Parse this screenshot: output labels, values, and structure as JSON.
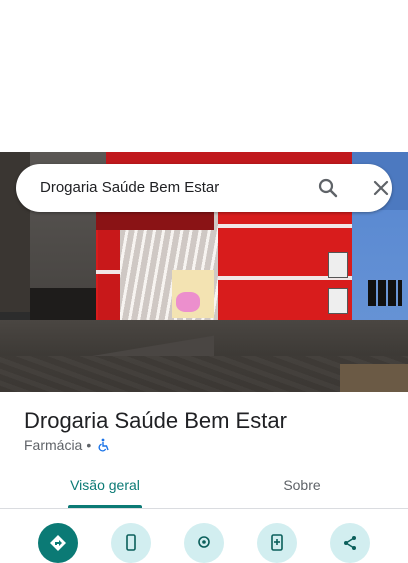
{
  "search": {
    "query": "Drogaria Saúde Bem Estar"
  },
  "place": {
    "name": "Drogaria Saúde Bem Estar",
    "category": "Farmácia",
    "separator": "•"
  },
  "tabs": [
    {
      "label": "Visão geral",
      "active": true
    },
    {
      "label": "Sobre",
      "active": false
    }
  ],
  "actions": [
    {
      "icon": "directions-icon"
    },
    {
      "icon": "phone-icon"
    },
    {
      "icon": "location-icon"
    },
    {
      "icon": "save-icon"
    },
    {
      "icon": "share-icon"
    }
  ],
  "colors": {
    "accent": "#0b7a75",
    "action_bg": "#d2eef0",
    "accessibility": "#1a73e8"
  }
}
